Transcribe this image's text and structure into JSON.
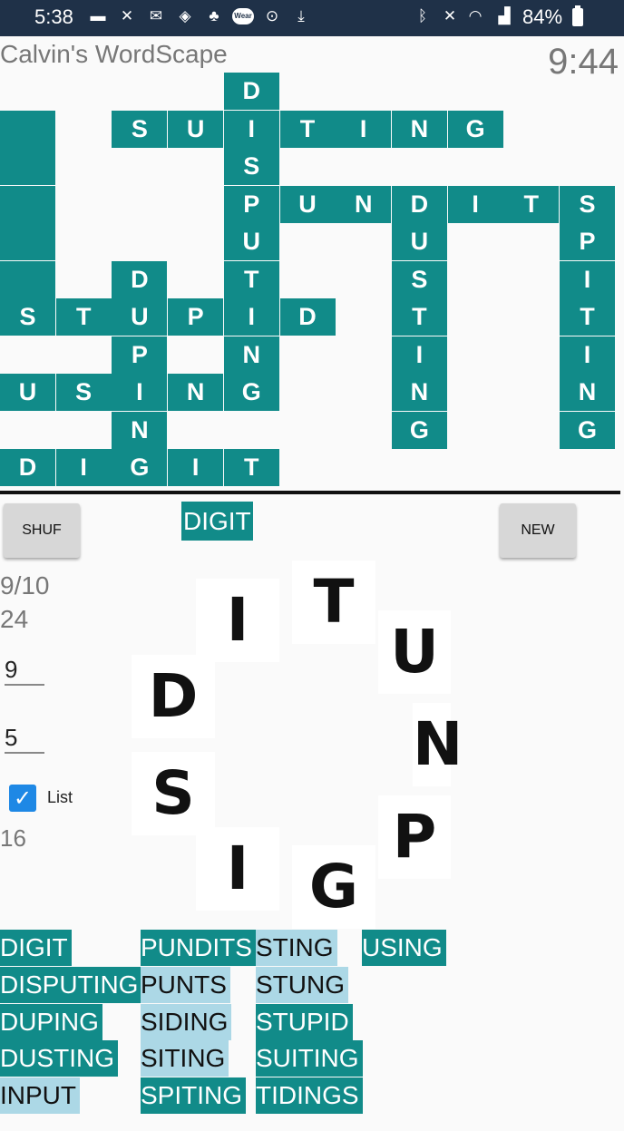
{
  "status_bar": {
    "time": "5:38",
    "battery": "84%",
    "icons": [
      "chat-icon",
      "missed-call-icon",
      "mail-icon",
      "shield-icon",
      "cat-icon",
      "wear-icon",
      "location-icon",
      "download-icon",
      "bluetooth-icon",
      "mute-icon",
      "wifi-icon",
      "signal-icon",
      "battery-icon"
    ],
    "wear_label": "Wear"
  },
  "header": {
    "title": "Calvin's WordScape",
    "timer": "9:44"
  },
  "board": {
    "rows": [
      "....D......",
      "X.SUITING..",
      "X...S......",
      "X...PUNDITS",
      "X...U..U..P",
      "X.D.T..S..I",
      "STUPID.T..T",
      "..P.N..I..I",
      "USING..N..N",
      "..N....G..G",
      "DIGIT......"
    ]
  },
  "controls": {
    "shuffle_label": "SHUF",
    "new_label": "NEW",
    "current_word": "DIGIT"
  },
  "stats": {
    "found": "9/10",
    "score": "24",
    "min_length": "9",
    "max_length": "5",
    "list_label": "List",
    "list_checked": true,
    "count": "16"
  },
  "wheel": {
    "letters": [
      {
        "letter": "T"
      },
      {
        "letter": "I"
      },
      {
        "letter": "U"
      },
      {
        "letter": "D"
      },
      {
        "letter": "N"
      },
      {
        "letter": "S"
      },
      {
        "letter": "P"
      },
      {
        "letter": "I"
      },
      {
        "letter": "G"
      }
    ]
  },
  "word_list": {
    "columns": [
      [
        {
          "word": "DIGIT",
          "found": true
        },
        {
          "word": "DISPUTING",
          "found": true
        },
        {
          "word": "DUPING",
          "found": true
        },
        {
          "word": "DUSTING",
          "found": true
        },
        {
          "word": "INPUT",
          "found": false
        }
      ],
      [
        {
          "word": "PUNDITS",
          "found": true
        },
        {
          "word": "PUNTS",
          "found": false
        },
        {
          "word": "SIDING",
          "found": false
        },
        {
          "word": "SITING",
          "found": false
        },
        {
          "word": "SPITING",
          "found": true
        }
      ],
      [
        {
          "word": "STING",
          "found": false
        },
        {
          "word": "STUNG",
          "found": false
        },
        {
          "word": "STUPID",
          "found": true
        },
        {
          "word": "SUITING",
          "found": true
        },
        {
          "word": "TIDINGS",
          "found": true
        }
      ],
      [
        {
          "word": "USING",
          "found": true
        }
      ]
    ]
  },
  "colors": {
    "tile": "#118b89",
    "found_bg": "#118b89",
    "unfound_bg": "#acd8e6",
    "status_bar": "#1f3148"
  }
}
